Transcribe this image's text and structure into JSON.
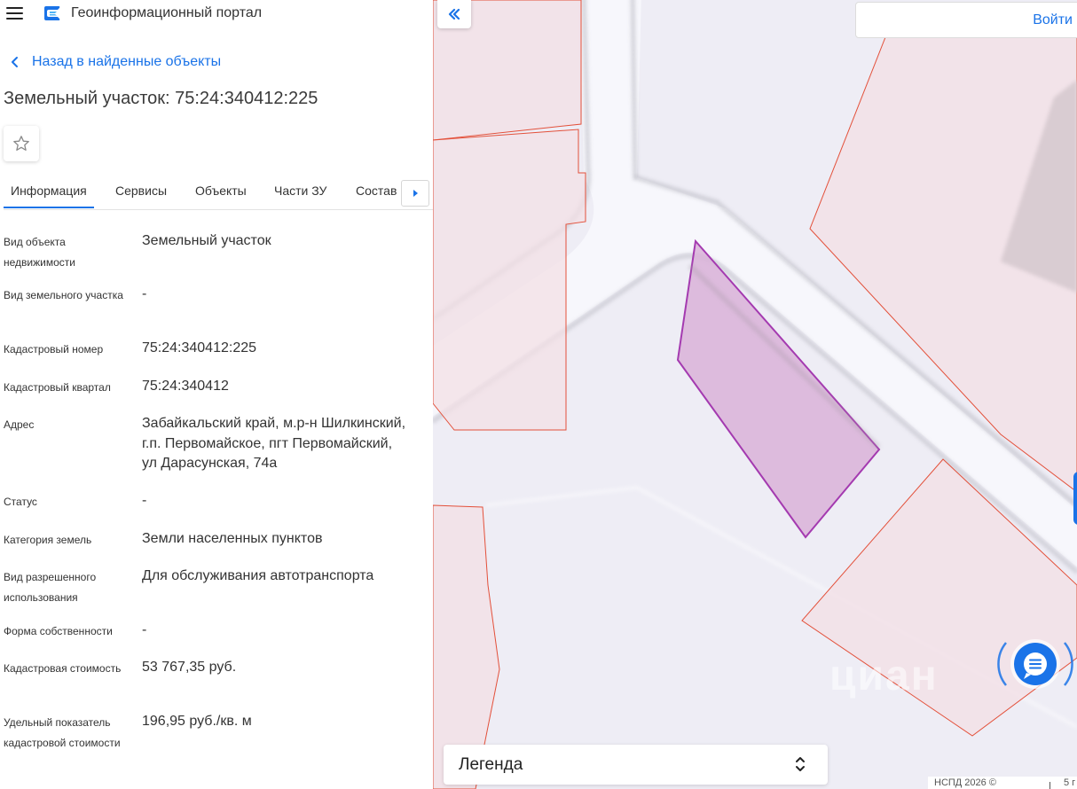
{
  "header": {
    "app_title": "Геоинформационный портал",
    "menu_icon": "hamburger-icon",
    "logo_icon": "portal-logo-icon"
  },
  "navigation": {
    "back_label": "Назад в найденные объекты"
  },
  "object": {
    "title": "Земельный участок: 75:24:340412:225"
  },
  "tabs": [
    {
      "label": "Информация",
      "active": true
    },
    {
      "label": "Сервисы"
    },
    {
      "label": "Объекты"
    },
    {
      "label": "Части ЗУ"
    },
    {
      "label": "Состав"
    }
  ],
  "attributes": [
    {
      "label": "Вид объекта недвижимости",
      "value": "Земельный участок"
    },
    {
      "label": "Вид земельного участка",
      "value": "-"
    },
    {
      "label": "Кадастровый номер",
      "value": "75:24:340412:225"
    },
    {
      "label": "Кадастровый квартал",
      "value": "75:24:340412"
    },
    {
      "label": "Адрес",
      "value": "Забайкальский край, м.р-н Шилкинский, г.п. Первомайское, пгт Первомайский, ул Дарасунская, 74а"
    },
    {
      "label": "Статус",
      "value": "-"
    },
    {
      "label": "Категория земель",
      "value": "Земли населенных пунктов"
    },
    {
      "label": "Вид разрешенного использования",
      "value": "Для обслуживания автотранспорта"
    },
    {
      "label": "Форма собственности",
      "value": "-"
    },
    {
      "label": "Кадастровая стоимость",
      "value": "53 767,35 руб."
    },
    {
      "label": "Удельный показатель кадастровой стоимости",
      "value": "196,95 руб./кв. м"
    }
  ],
  "map": {
    "login_label": "Войти",
    "legend_label": "Легенда",
    "copyright": "НСПД 2026 ©",
    "scale_label": "5 г",
    "watermark": "циан",
    "colors": {
      "background": "#eeedf5",
      "parcel_fill": "#f3e0e6",
      "parcel_stroke": "#e3503a",
      "selected_fill": "#d9b2d8",
      "selected_stroke": "#a43ab0",
      "accent": "#1a73e8"
    }
  }
}
